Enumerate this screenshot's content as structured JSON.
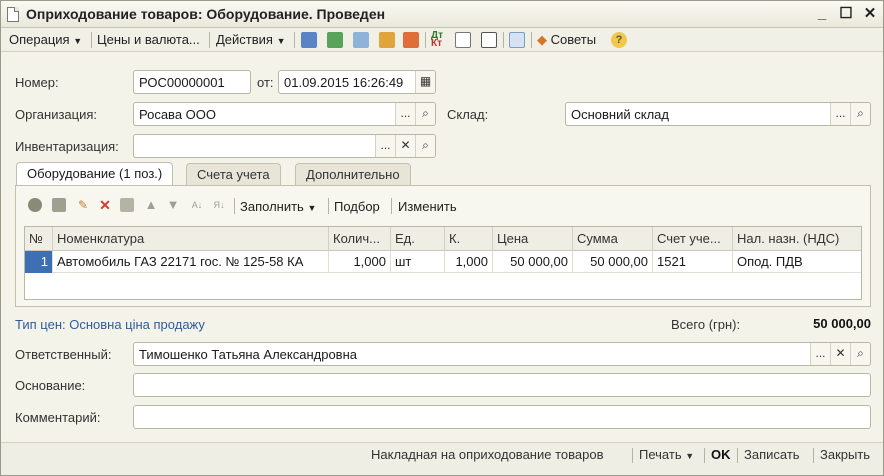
{
  "window": {
    "title": "Оприходование товаров: Оборудование. Проведен",
    "controls": [
      "_",
      "☐",
      "✕"
    ]
  },
  "toolbar": {
    "operation": "Операция",
    "prices_currency": "Цены и валюта...",
    "actions": "Действия",
    "tips": "Советы"
  },
  "form": {
    "number_label": "Номер:",
    "number_value": "РОС00000001",
    "date_label": "от:",
    "date_value": "01.09.2015 16:26:49",
    "organization_label": "Организация:",
    "organization_value": "Росава ООО",
    "warehouse_label": "Склад:",
    "warehouse_value": "Основний склад",
    "inventory_label": "Инвентаризация:",
    "inventory_value": "",
    "responsible_label": "Ответственный:",
    "responsible_value": "Тимошенко Татьяна Александровна",
    "basis_label": "Основание:",
    "basis_value": "",
    "comment_label": "Комментарий:",
    "comment_value": ""
  },
  "tabs": [
    {
      "label": "Оборудование (1 поз.)",
      "active": true
    },
    {
      "label": "Счета учета",
      "active": false
    },
    {
      "label": "Дополнительно",
      "active": false
    }
  ],
  "grid_toolbar": {
    "fill": "Заполнить",
    "selection": "Подбор",
    "change": "Изменить"
  },
  "table": {
    "columns": [
      "№",
      "Номенклатура",
      "Колич...",
      "Ед.",
      "К.",
      "Цена",
      "Сумма",
      "Счет уче...",
      "Нал. назн. (НДС)"
    ],
    "rows": [
      [
        "1",
        "Автомобиль ГАЗ 22171 гос. № 125-58 КА",
        "1,000",
        "шт",
        "1,000",
        "50 000,00",
        "50 000,00",
        "1521",
        "Опод. ПДВ"
      ]
    ]
  },
  "footer": {
    "price_type": "Тип цен: Основна ціна продажу",
    "total_label": "Всего (грн):",
    "total_value": "50 000,00"
  },
  "bottom": {
    "invoice": "Накладная на оприходование товаров",
    "print": "Печать",
    "ok": "OK",
    "save": "Записать",
    "close": "Закрыть"
  },
  "colors": {
    "accent": "#3d6fb5",
    "link": "#2f5c9d",
    "background": "#f4f3ea"
  }
}
